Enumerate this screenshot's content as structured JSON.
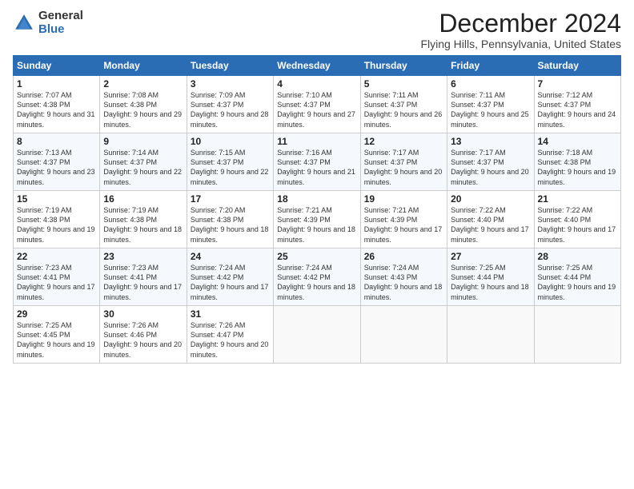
{
  "logo": {
    "general": "General",
    "blue": "Blue"
  },
  "title": "December 2024",
  "location": "Flying Hills, Pennsylvania, United States",
  "days_of_week": [
    "Sunday",
    "Monday",
    "Tuesday",
    "Wednesday",
    "Thursday",
    "Friday",
    "Saturday"
  ],
  "weeks": [
    [
      {
        "day": "1",
        "sunrise": "Sunrise: 7:07 AM",
        "sunset": "Sunset: 4:38 PM",
        "daylight": "Daylight: 9 hours and 31 minutes."
      },
      {
        "day": "2",
        "sunrise": "Sunrise: 7:08 AM",
        "sunset": "Sunset: 4:38 PM",
        "daylight": "Daylight: 9 hours and 29 minutes."
      },
      {
        "day": "3",
        "sunrise": "Sunrise: 7:09 AM",
        "sunset": "Sunset: 4:37 PM",
        "daylight": "Daylight: 9 hours and 28 minutes."
      },
      {
        "day": "4",
        "sunrise": "Sunrise: 7:10 AM",
        "sunset": "Sunset: 4:37 PM",
        "daylight": "Daylight: 9 hours and 27 minutes."
      },
      {
        "day": "5",
        "sunrise": "Sunrise: 7:11 AM",
        "sunset": "Sunset: 4:37 PM",
        "daylight": "Daylight: 9 hours and 26 minutes."
      },
      {
        "day": "6",
        "sunrise": "Sunrise: 7:11 AM",
        "sunset": "Sunset: 4:37 PM",
        "daylight": "Daylight: 9 hours and 25 minutes."
      },
      {
        "day": "7",
        "sunrise": "Sunrise: 7:12 AM",
        "sunset": "Sunset: 4:37 PM",
        "daylight": "Daylight: 9 hours and 24 minutes."
      }
    ],
    [
      {
        "day": "8",
        "sunrise": "Sunrise: 7:13 AM",
        "sunset": "Sunset: 4:37 PM",
        "daylight": "Daylight: 9 hours and 23 minutes."
      },
      {
        "day": "9",
        "sunrise": "Sunrise: 7:14 AM",
        "sunset": "Sunset: 4:37 PM",
        "daylight": "Daylight: 9 hours and 22 minutes."
      },
      {
        "day": "10",
        "sunrise": "Sunrise: 7:15 AM",
        "sunset": "Sunset: 4:37 PM",
        "daylight": "Daylight: 9 hours and 22 minutes."
      },
      {
        "day": "11",
        "sunrise": "Sunrise: 7:16 AM",
        "sunset": "Sunset: 4:37 PM",
        "daylight": "Daylight: 9 hours and 21 minutes."
      },
      {
        "day": "12",
        "sunrise": "Sunrise: 7:17 AM",
        "sunset": "Sunset: 4:37 PM",
        "daylight": "Daylight: 9 hours and 20 minutes."
      },
      {
        "day": "13",
        "sunrise": "Sunrise: 7:17 AM",
        "sunset": "Sunset: 4:37 PM",
        "daylight": "Daylight: 9 hours and 20 minutes."
      },
      {
        "day": "14",
        "sunrise": "Sunrise: 7:18 AM",
        "sunset": "Sunset: 4:38 PM",
        "daylight": "Daylight: 9 hours and 19 minutes."
      }
    ],
    [
      {
        "day": "15",
        "sunrise": "Sunrise: 7:19 AM",
        "sunset": "Sunset: 4:38 PM",
        "daylight": "Daylight: 9 hours and 19 minutes."
      },
      {
        "day": "16",
        "sunrise": "Sunrise: 7:19 AM",
        "sunset": "Sunset: 4:38 PM",
        "daylight": "Daylight: 9 hours and 18 minutes."
      },
      {
        "day": "17",
        "sunrise": "Sunrise: 7:20 AM",
        "sunset": "Sunset: 4:38 PM",
        "daylight": "Daylight: 9 hours and 18 minutes."
      },
      {
        "day": "18",
        "sunrise": "Sunrise: 7:21 AM",
        "sunset": "Sunset: 4:39 PM",
        "daylight": "Daylight: 9 hours and 18 minutes."
      },
      {
        "day": "19",
        "sunrise": "Sunrise: 7:21 AM",
        "sunset": "Sunset: 4:39 PM",
        "daylight": "Daylight: 9 hours and 17 minutes."
      },
      {
        "day": "20",
        "sunrise": "Sunrise: 7:22 AM",
        "sunset": "Sunset: 4:40 PM",
        "daylight": "Daylight: 9 hours and 17 minutes."
      },
      {
        "day": "21",
        "sunrise": "Sunrise: 7:22 AM",
        "sunset": "Sunset: 4:40 PM",
        "daylight": "Daylight: 9 hours and 17 minutes."
      }
    ],
    [
      {
        "day": "22",
        "sunrise": "Sunrise: 7:23 AM",
        "sunset": "Sunset: 4:41 PM",
        "daylight": "Daylight: 9 hours and 17 minutes."
      },
      {
        "day": "23",
        "sunrise": "Sunrise: 7:23 AM",
        "sunset": "Sunset: 4:41 PM",
        "daylight": "Daylight: 9 hours and 17 minutes."
      },
      {
        "day": "24",
        "sunrise": "Sunrise: 7:24 AM",
        "sunset": "Sunset: 4:42 PM",
        "daylight": "Daylight: 9 hours and 17 minutes."
      },
      {
        "day": "25",
        "sunrise": "Sunrise: 7:24 AM",
        "sunset": "Sunset: 4:42 PM",
        "daylight": "Daylight: 9 hours and 18 minutes."
      },
      {
        "day": "26",
        "sunrise": "Sunrise: 7:24 AM",
        "sunset": "Sunset: 4:43 PM",
        "daylight": "Daylight: 9 hours and 18 minutes."
      },
      {
        "day": "27",
        "sunrise": "Sunrise: 7:25 AM",
        "sunset": "Sunset: 4:44 PM",
        "daylight": "Daylight: 9 hours and 18 minutes."
      },
      {
        "day": "28",
        "sunrise": "Sunrise: 7:25 AM",
        "sunset": "Sunset: 4:44 PM",
        "daylight": "Daylight: 9 hours and 19 minutes."
      }
    ],
    [
      {
        "day": "29",
        "sunrise": "Sunrise: 7:25 AM",
        "sunset": "Sunset: 4:45 PM",
        "daylight": "Daylight: 9 hours and 19 minutes."
      },
      {
        "day": "30",
        "sunrise": "Sunrise: 7:26 AM",
        "sunset": "Sunset: 4:46 PM",
        "daylight": "Daylight: 9 hours and 20 minutes."
      },
      {
        "day": "31",
        "sunrise": "Sunrise: 7:26 AM",
        "sunset": "Sunset: 4:47 PM",
        "daylight": "Daylight: 9 hours and 20 minutes."
      },
      null,
      null,
      null,
      null
    ]
  ]
}
